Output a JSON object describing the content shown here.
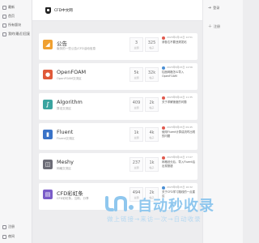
{
  "sidebar": {
    "items": [
      {
        "label": "最新"
      },
      {
        "label": "首页"
      },
      {
        "label": "所有版块"
      },
      {
        "label": "我的(最近)回复"
      }
    ],
    "bottom": [
      {
        "label": "注册"
      },
      {
        "label": "夜间"
      }
    ]
  },
  "header": {
    "site_title": "CFD中文网"
  },
  "rightbar": {
    "items": [
      {
        "label": "登录",
        "icon": "login-icon"
      },
      {
        "label": "注册",
        "icon": "register-icon"
      }
    ]
  },
  "forums": [
    {
      "name": "公告",
      "desc": "版务的一些公告/CFD活动信息",
      "color": "#f0a030",
      "icon": "announcement-icon",
      "topics": "3",
      "topics_label": "主题",
      "posts": "325",
      "posts_label": "帖子",
      "latest_time": "2023年2月14日 12:51",
      "latest_text": "请各位不要违规发帖",
      "dot_color": "#e05a4f"
    },
    {
      "name": "OpenFOAM",
      "desc": "OpenFOAM交流区",
      "color": "#e05a3a",
      "icon": "openfoam-icon",
      "topics": "5k",
      "topics_label": "主题",
      "posts": "32k",
      "posts_label": "帖子",
      "latest_time": "2023年8月25日 14:56",
      "latest_text": "柱面网格怎么导入OpenFOAM",
      "dot_color": "#4a8fd4"
    },
    {
      "name": "Algorithm",
      "desc": "算法交流区",
      "color": "#3aa4a0",
      "icon": "algorithm-icon",
      "topics": "409",
      "topics_label": "主题",
      "posts": "2k",
      "posts_label": "帖子",
      "latest_time": "2023年8月24日 11:35",
      "latest_text": "关于求解速度的问题",
      "dot_color": "#e05a4f"
    },
    {
      "name": "Fluent",
      "desc": "Fluent交流区",
      "color": "#3a73c8",
      "icon": "fluent-icon",
      "topics": "1k",
      "topics_label": "主题",
      "posts": "4k",
      "posts_label": "帖子",
      "latest_time": "2023年8月25日 09:45",
      "latest_text": "使用Fluent计算湍流时出现的问题",
      "dot_color": "#e05a4f"
    },
    {
      "name": "Meshy",
      "desc": "网格交流区",
      "color": "#6c6c76",
      "icon": "mesh-icon",
      "topics": "237",
      "topics_label": "主题",
      "posts": "1k",
      "posts_label": "帖子",
      "latest_time": "2023年8月24日 17:07",
      "latest_text": "网格划分后，导入Fluent后出现报错",
      "dot_color": "#e05a4f"
    },
    {
      "name": "CFD彩虹条",
      "desc": "CFD彩虹条。互助，分享",
      "color": "#7a5cc8",
      "icon": "rainbow-icon",
      "topics": "494",
      "topics_label": "主题",
      "posts": "2k",
      "posts_label": "帖子",
      "latest_time": "2023年8月25日 16:32",
      "latest_text": "关于CFD学习路线的一点建议",
      "dot_color": "#4a8fd4"
    }
  ],
  "watermark": {
    "title": "自动秒收录",
    "slogan": "做上链接→来访一次→自动收录"
  }
}
